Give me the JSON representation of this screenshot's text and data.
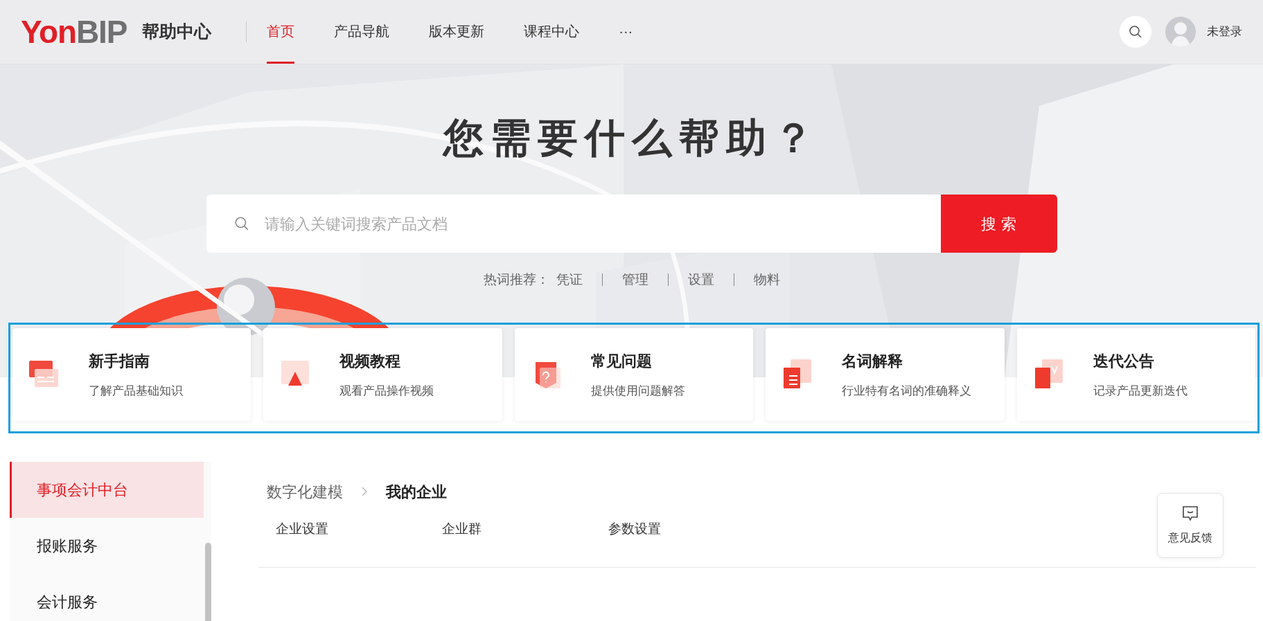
{
  "header": {
    "logo": {
      "accent": "Yon",
      "rest": "BIP"
    },
    "site_title": "帮助中心",
    "nav": [
      {
        "label": "首页",
        "selected": true
      },
      {
        "label": "产品导航",
        "selected": false
      },
      {
        "label": "版本更新",
        "selected": false
      },
      {
        "label": "课程中心",
        "selected": false
      },
      {
        "label": "···",
        "selected": false
      }
    ],
    "user": "未登录"
  },
  "hero": {
    "title": "您需要什么帮助？",
    "search": {
      "placeholder": "请输入关键词搜索产品文档",
      "button": "搜 索"
    },
    "hot_words": {
      "label": "热词推荐：",
      "items": [
        "凭证",
        "管理",
        "设置",
        "物料"
      ]
    }
  },
  "cards": [
    {
      "title": "新手指南",
      "desc": "了解产品基础知识"
    },
    {
      "title": "视频教程",
      "desc": "观看产品操作视频"
    },
    {
      "title": "常见问题",
      "desc": "提供使用问题解答"
    },
    {
      "title": "名词解释",
      "desc": "行业特有名词的准确释义"
    },
    {
      "title": "迭代公告",
      "desc": "记录产品更新迭代"
    }
  ],
  "sidebar": {
    "items": [
      {
        "label": "事项会计中台",
        "selected": true
      },
      {
        "label": "报账服务",
        "selected": false
      },
      {
        "label": "会计服务",
        "selected": false
      }
    ]
  },
  "sections": [
    {
      "parent": "数字化建模",
      "title": "我的企业",
      "links": [
        "企业设置",
        "企业群",
        "参数设置"
      ]
    }
  ],
  "feedback": "意见反馈"
}
